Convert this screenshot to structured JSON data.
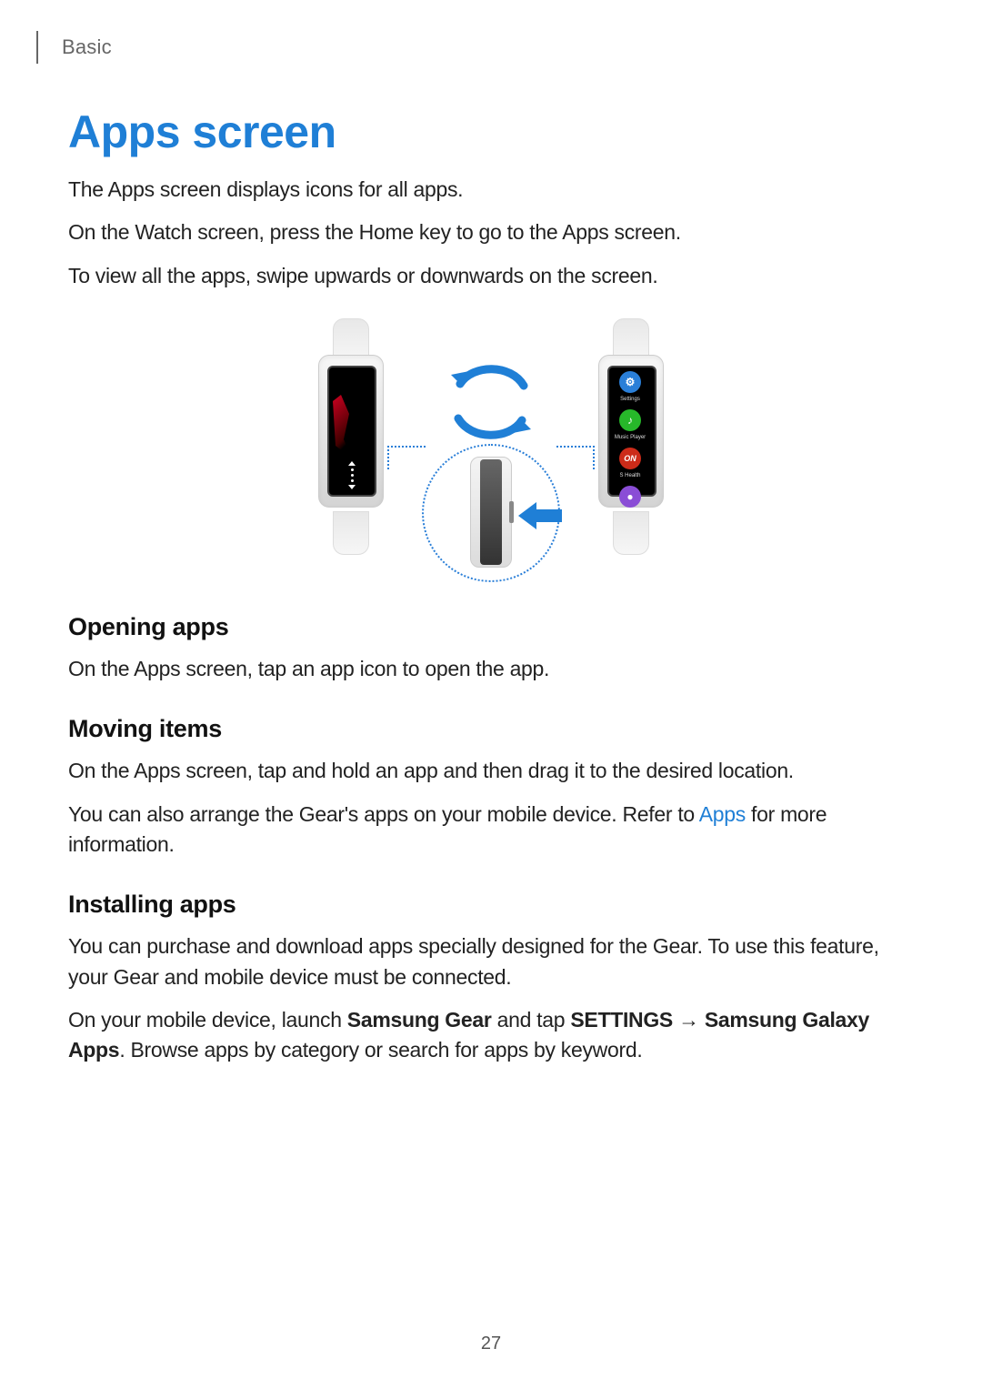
{
  "breadcrumb": "Basic",
  "title": "Apps screen",
  "intro": [
    "The Apps screen displays icons for all apps.",
    "On the Watch screen, press the Home key to go to the Apps screen.",
    "To view all the apps, swipe upwards or downwards on the screen."
  ],
  "figure": {
    "left_icons": {
      "settings": "⚙",
      "music": "♪",
      "shealth": "ON",
      "other": "●"
    },
    "arrow_color": "#1f7fd6"
  },
  "sections": {
    "opening_apps": {
      "heading": "Opening apps",
      "body": "On the Apps screen, tap an app icon to open the app."
    },
    "moving_items": {
      "heading": "Moving items",
      "p1": "On the Apps screen, tap and hold an app and then drag it to the desired location.",
      "p2_pre": "You can also arrange the Gear's apps on your mobile device. Refer to ",
      "p2_link": "Apps",
      "p2_post": " for more information."
    },
    "installing_apps": {
      "heading": "Installing apps",
      "p1": "You can purchase and download apps specially designed for the Gear. To use this feature, your Gear and mobile device must be connected.",
      "p2_pre": "On your mobile device, launch ",
      "p2_bold1": "Samsung Gear",
      "p2_mid1": " and tap ",
      "p2_bold2": "SETTINGS",
      "p2_arrow": " → ",
      "p2_bold3": "Samsung Galaxy Apps",
      "p2_post": ". Browse apps by category or search for apps by keyword."
    }
  },
  "page_number": "27"
}
